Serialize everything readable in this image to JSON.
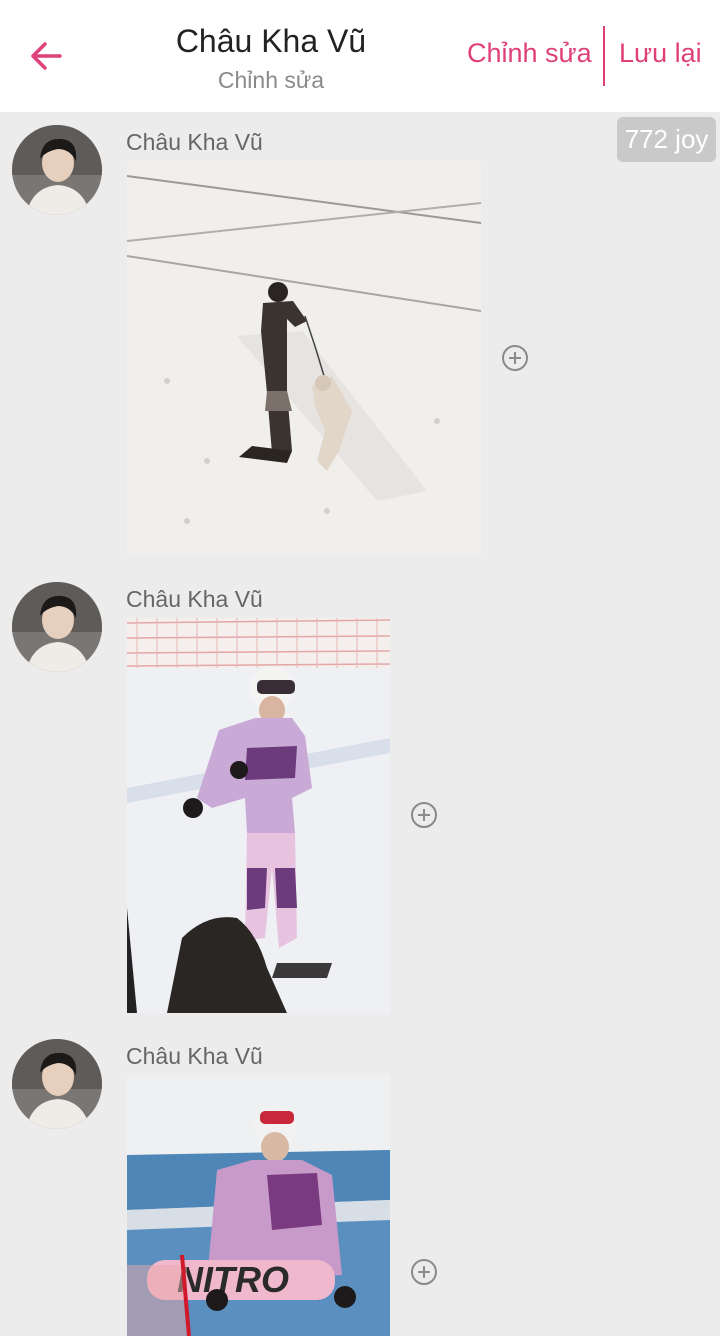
{
  "header": {
    "title": "Châu Kha Vũ",
    "subtitle": "Chỉnh sửa",
    "edit_label": "Chỉnh sửa",
    "save_label": "Lưu lại",
    "accent": "#e0407a"
  },
  "joy_badge": "772 joy",
  "posts": [
    {
      "author": "Châu Kha Vũ"
    },
    {
      "author": "Châu Kha Vũ"
    },
    {
      "author": "Châu Kha Vũ"
    }
  ]
}
